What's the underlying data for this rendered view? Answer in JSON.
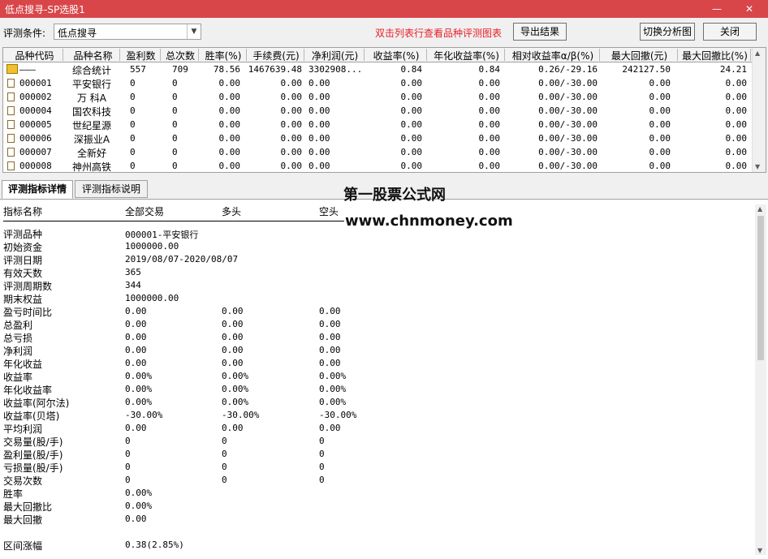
{
  "window": {
    "title": "低点搜寻-SP选股1",
    "minimize_glyph": "—",
    "close_glyph": "✕"
  },
  "toolbar": {
    "condition_label": "评测条件:",
    "condition_value": "低点搜寻",
    "hint": "双击列表行查看品种评测图表",
    "export_label": "导出结果",
    "switch_label": "切换分析图",
    "close_label": "关闭"
  },
  "grid": {
    "columns": [
      "品种代码",
      "品种名称",
      "盈利数",
      "总次数",
      "胜率(%)",
      "手续费(元)",
      "净利润(元)",
      "收益率(%)",
      "年化收益率(%)",
      "相对收益率α/β(%)",
      "最大回撤(元)",
      "最大回撤比(%)"
    ],
    "summary": {
      "code": "———",
      "name": "综合统计",
      "win": "557",
      "total": "709",
      "rate": "78.56",
      "fee": "1467639.48",
      "net": "3302908...",
      "ret": "0.84",
      "annual": "0.84",
      "rel": "0.26/-29.16",
      "dd": "242127.50",
      "ddr": "24.21"
    },
    "rows": [
      {
        "code": "000001",
        "name": "平安银行",
        "win": "0",
        "total": "0",
        "rate": "0.00",
        "fee": "0.00",
        "net": "0.00",
        "ret": "0.00",
        "annual": "0.00",
        "rel": "0.00/-30.00",
        "dd": "0.00",
        "ddr": "0.00"
      },
      {
        "code": "000002",
        "name": "万  科A",
        "win": "0",
        "total": "0",
        "rate": "0.00",
        "fee": "0.00",
        "net": "0.00",
        "ret": "0.00",
        "annual": "0.00",
        "rel": "0.00/-30.00",
        "dd": "0.00",
        "ddr": "0.00"
      },
      {
        "code": "000004",
        "name": "国农科技",
        "win": "0",
        "total": "0",
        "rate": "0.00",
        "fee": "0.00",
        "net": "0.00",
        "ret": "0.00",
        "annual": "0.00",
        "rel": "0.00/-30.00",
        "dd": "0.00",
        "ddr": "0.00"
      },
      {
        "code": "000005",
        "name": "世纪星源",
        "win": "0",
        "total": "0",
        "rate": "0.00",
        "fee": "0.00",
        "net": "0.00",
        "ret": "0.00",
        "annual": "0.00",
        "rel": "0.00/-30.00",
        "dd": "0.00",
        "ddr": "0.00"
      },
      {
        "code": "000006",
        "name": "深振业A",
        "win": "0",
        "total": "0",
        "rate": "0.00",
        "fee": "0.00",
        "net": "0.00",
        "ret": "0.00",
        "annual": "0.00",
        "rel": "0.00/-30.00",
        "dd": "0.00",
        "ddr": "0.00"
      },
      {
        "code": "000007",
        "name": "全新好",
        "win": "0",
        "total": "0",
        "rate": "0.00",
        "fee": "0.00",
        "net": "0.00",
        "ret": "0.00",
        "annual": "0.00",
        "rel": "0.00/-30.00",
        "dd": "0.00",
        "ddr": "0.00"
      },
      {
        "code": "000008",
        "name": "神州高铁",
        "win": "0",
        "total": "0",
        "rate": "0.00",
        "fee": "0.00",
        "net": "0.00",
        "ret": "0.00",
        "annual": "0.00",
        "rel": "0.00/-30.00",
        "dd": "0.00",
        "ddr": "0.00"
      }
    ]
  },
  "tabs": {
    "detail": "评测指标详情",
    "explain": "评测指标说明"
  },
  "watermark": {
    "line1": "第一股票公式网",
    "line2": "www.chnmoney.com"
  },
  "detail": {
    "headers": {
      "name": "指标名称",
      "all": "全部交易",
      "long": "多头",
      "short": "空头"
    },
    "metrics": [
      {
        "name": "评测品种",
        "all": "000001-平安银行",
        "long": "",
        "short": ""
      },
      {
        "name": "初始资金",
        "all": "1000000.00",
        "long": "",
        "short": ""
      },
      {
        "name": "评测日期",
        "all": "2019/08/07-2020/08/07",
        "long": "",
        "short": ""
      },
      {
        "name": "有效天数",
        "all": "365",
        "long": "",
        "short": ""
      },
      {
        "name": "评测周期数",
        "all": "344",
        "long": "",
        "short": ""
      },
      {
        "name": "期末权益",
        "all": "1000000.00",
        "long": "",
        "short": ""
      },
      {
        "name": "盈亏时间比",
        "all": "0.00",
        "long": "0.00",
        "short": "0.00"
      },
      {
        "name": "总盈利",
        "all": "0.00",
        "long": "0.00",
        "short": "0.00"
      },
      {
        "name": "总亏损",
        "all": "0.00",
        "long": "0.00",
        "short": "0.00"
      },
      {
        "name": "净利润",
        "all": "0.00",
        "long": "0.00",
        "short": "0.00"
      },
      {
        "name": "年化收益",
        "all": "0.00",
        "long": "0.00",
        "short": "0.00"
      },
      {
        "name": "收益率",
        "all": "0.00%",
        "long": "0.00%",
        "short": "0.00%"
      },
      {
        "name": "年化收益率",
        "all": "0.00%",
        "long": "0.00%",
        "short": "0.00%"
      },
      {
        "name": "收益率(阿尔法)",
        "all": "0.00%",
        "long": "0.00%",
        "short": "0.00%"
      },
      {
        "name": "收益率(贝塔)",
        "all": "-30.00%",
        "long": "-30.00%",
        "short": "-30.00%"
      },
      {
        "name": "平均利润",
        "all": "0.00",
        "long": "0.00",
        "short": "0.00"
      },
      {
        "name": "交易量(股/手)",
        "all": "0",
        "long": "0",
        "short": "0"
      },
      {
        "name": "盈利量(股/手)",
        "all": "0",
        "long": "0",
        "short": "0"
      },
      {
        "name": "亏损量(股/手)",
        "all": "0",
        "long": "0",
        "short": "0"
      },
      {
        "name": "交易次数",
        "all": "0",
        "long": "0",
        "short": "0"
      },
      {
        "name": "胜率",
        "all": "0.00%",
        "long": "",
        "short": ""
      },
      {
        "name": "最大回撤比",
        "all": "0.00%",
        "long": "",
        "short": ""
      },
      {
        "name": "最大回撤",
        "all": "0.00",
        "long": "",
        "short": ""
      },
      {
        "name": "",
        "all": "",
        "long": "",
        "short": ""
      },
      {
        "name": "区间涨幅",
        "all": "0.38(2.85%)",
        "long": "",
        "short": ""
      }
    ]
  }
}
